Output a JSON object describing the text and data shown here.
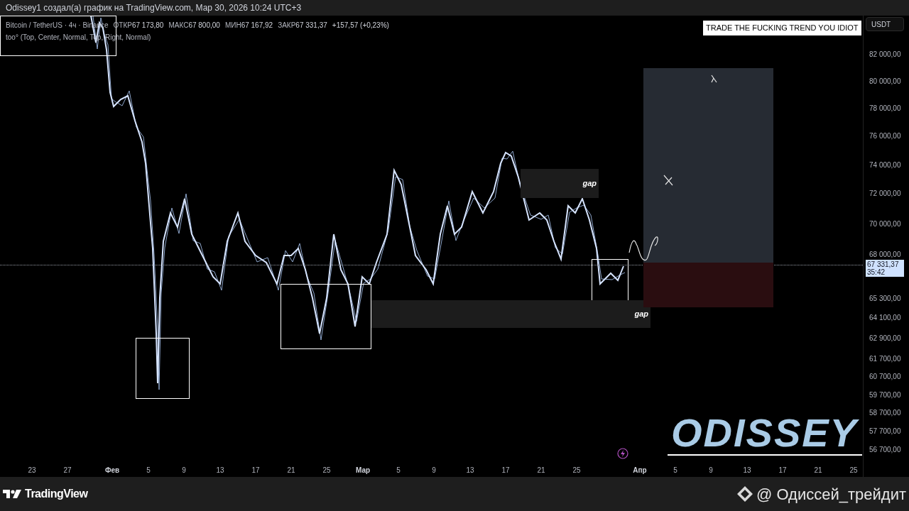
{
  "header": {
    "attribution": "Odissey1 создал(а) график на TradingView.com, Мар 30, 2026 10:24 UTC+3"
  },
  "legend": {
    "symbol": "Bitcoin / TetherUS · 4ч · Binance",
    "ohlc": [
      {
        "label": "ОТКР",
        "value": "67 173,80"
      },
      {
        "label": "МАКС",
        "value": "67 800,00"
      },
      {
        "label": "МИН",
        "value": "67 167,92"
      },
      {
        "label": "ЗАКР",
        "value": "67 331,37"
      }
    ],
    "change": "+157,57 (+0,23%)",
    "indicator": "too° (Top, Center, Normal, Top, Right, Normal)"
  },
  "note": "TRADE THE FUCKING TREND YOU IDIOT",
  "currency_button": "USDT",
  "price_axis": [
    "82 000,00",
    "80 000,00",
    "78 000,00",
    "76 000,00",
    "74 000,00",
    "72 000,00",
    "70 000,00",
    "68 000,00",
    "65 300,00",
    "64 100,00",
    "62 900,00",
    "61 700,00",
    "60 700,00",
    "59 700,00",
    "58 700,00",
    "57 700,00",
    "56 700,00"
  ],
  "last_price": {
    "price": "67 331,37",
    "countdown": "35:42"
  },
  "time_axis": [
    {
      "label": "23",
      "kind": "day"
    },
    {
      "label": "27",
      "kind": "day"
    },
    {
      "label": "Фев",
      "kind": "month"
    },
    {
      "label": "5",
      "kind": "day"
    },
    {
      "label": "9",
      "kind": "day"
    },
    {
      "label": "13",
      "kind": "day"
    },
    {
      "label": "17",
      "kind": "day"
    },
    {
      "label": "21",
      "kind": "day"
    },
    {
      "label": "25",
      "kind": "day"
    },
    {
      "label": "Мар",
      "kind": "month"
    },
    {
      "label": "5",
      "kind": "day"
    },
    {
      "label": "9",
      "kind": "day"
    },
    {
      "label": "13",
      "kind": "day"
    },
    {
      "label": "17",
      "kind": "day"
    },
    {
      "label": "21",
      "kind": "day"
    },
    {
      "label": "25",
      "kind": "day"
    },
    {
      "label": "Апр",
      "kind": "month"
    },
    {
      "label": "5",
      "kind": "day"
    },
    {
      "label": "9",
      "kind": "day"
    },
    {
      "label": "13",
      "kind": "day"
    },
    {
      "label": "17",
      "kind": "day"
    },
    {
      "label": "21",
      "kind": "day"
    },
    {
      "label": "25",
      "kind": "day"
    }
  ],
  "gap_labels": [
    "gap",
    "gap"
  ],
  "logo_overlay": "ODISSEY",
  "footer": {
    "brand": "TradingView",
    "channel": "@ Одиссей_трейдит"
  }
}
